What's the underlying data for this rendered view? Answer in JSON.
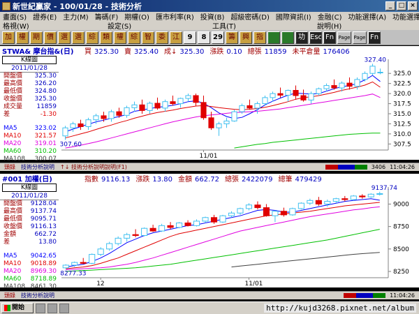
{
  "window": {
    "title": "新世紀贏家 - 100/01/28 - 技術分析"
  },
  "menu": {
    "row1": [
      "畫面(S)",
      "證券(E)",
      "主力(M)",
      "籌碼(F)",
      "期權(O)",
      "匯市利率(R)",
      "投資(B)",
      "超級密碼(D)",
      "國際資訊(I)",
      "金融(C)",
      "功能選擇(A)",
      "功能選擇(P)"
    ],
    "row2": [
      "格視(W)",
      "設定(S)",
      "工具(T)",
      "說明(H)"
    ]
  },
  "toolbar": [
    "加",
    "權",
    "期",
    "價",
    "選",
    "選",
    "綜",
    "類",
    "權",
    "綜",
    "智",
    "委",
    "江",
    "9",
    "8",
    "29",
    "籌",
    "興",
    "指",
    "",
    "",
    "功能",
    "Esc",
    "Fn",
    "Page Up",
    "Page Down",
    "Fn"
  ],
  "top": {
    "symbol": "STWA& 摩台指&(日)",
    "fields": [
      {
        "label": "買",
        "value": "325.30"
      },
      {
        "label": "賣",
        "value": "325.40"
      },
      {
        "label": "成↓",
        "value": "325.30"
      },
      {
        "label": "漲跌",
        "value": "0.10"
      },
      {
        "label": "總張",
        "value": "11859"
      },
      {
        "label": "未平倉量",
        "value": "176406"
      }
    ],
    "kchart": "K線圖",
    "date": "2011/01/28",
    "stats": [
      {
        "k": "開盤價",
        "v": "325.30"
      },
      {
        "k": "最高價",
        "v": "326.20"
      },
      {
        "k": "最低價",
        "v": "324.80"
      },
      {
        "k": "收盤價",
        "v": "325.30"
      },
      {
        "k": "成交量",
        "v": "11859"
      },
      {
        "k": "差",
        "v": "-1.30"
      }
    ],
    "ma": [
      {
        "k": "MA5",
        "v": "323.02",
        "color": "#0000ff"
      },
      {
        "k": "MA10",
        "v": "321.57",
        "color": "#e00000"
      },
      {
        "k": "MA20",
        "v": "319.01",
        "color": "#e000e0"
      },
      {
        "k": "MA60",
        "v": "310.20",
        "color": "#00c000"
      },
      {
        "k": "MA108",
        "v": "300.07",
        "color": "#404040"
      }
    ],
    "status": {
      "s1": "頭錄",
      "s2": "技術分析說明",
      "s3": "↑↓ 技術分析說明說明(F1)",
      "count": "3406",
      "clock": "11:04:26"
    }
  },
  "bottom": {
    "symbol": "#001 加權(日)",
    "fields": [
      {
        "label": "指數",
        "value": "9116.13"
      },
      {
        "label": "漲跌",
        "value": "13.80"
      },
      {
        "label": "金額",
        "value": "662.72"
      },
      {
        "label": "總張",
        "value": "2422079"
      },
      {
        "label": "總筆",
        "value": "479429"
      }
    ],
    "kchart": "K線圖",
    "date": "2011/01/28",
    "stats": [
      {
        "k": "開盤價",
        "v": "9128.04"
      },
      {
        "k": "最高價",
        "v": "9137.74"
      },
      {
        "k": "最低價",
        "v": "9095.71"
      },
      {
        "k": "收盤價",
        "v": "9116.13"
      },
      {
        "k": "金額",
        "v": "662.72"
      },
      {
        "k": "差",
        "v": "13.80"
      }
    ],
    "ma": [
      {
        "k": "MA5",
        "v": "9042.65",
        "color": "#0000ff"
      },
      {
        "k": "MA10",
        "v": "9018.89",
        "color": "#e00000"
      },
      {
        "k": "MA20",
        "v": "8969.30",
        "color": "#e000e0"
      },
      {
        "k": "MA60",
        "v": "8718.89",
        "color": "#00c000"
      },
      {
        "k": "MA108",
        "v": "8461.30",
        "color": "#404040"
      }
    ],
    "status": {
      "s1": "頭錄",
      "s2": "技術分析說明",
      "s3": "",
      "count": "",
      "clock": "11:04:26"
    }
  },
  "taskbar": {
    "start": "開始",
    "watermark": "http://kujd3268.pixnet.net/album"
  },
  "chart_data": [
    {
      "type": "candlestick",
      "title": "STWA& 摩台指&(日)",
      "yticks": [
        307.5,
        310.0,
        312.5,
        315.0,
        317.5,
        320.0,
        322.5,
        325.0
      ],
      "ylim": [
        306.0,
        328.5
      ],
      "xticklabels": [
        "11/01"
      ],
      "annotations": {
        "high": "327.40",
        "low": "307.60"
      },
      "candles": [
        [
          309.5,
          312.0,
          308.5,
          311.5
        ],
        [
          311.5,
          313.0,
          310.5,
          312.5
        ],
        [
          312.5,
          313.5,
          311.0,
          311.8
        ],
        [
          311.8,
          314.0,
          311.0,
          313.5
        ],
        [
          313.5,
          315.0,
          312.5,
          314.5
        ],
        [
          314.5,
          315.5,
          313.0,
          313.8
        ],
        [
          313.8,
          316.0,
          313.0,
          315.5
        ],
        [
          315.5,
          316.5,
          314.0,
          314.6
        ],
        [
          314.6,
          317.0,
          314.0,
          316.5
        ],
        [
          316.5,
          318.0,
          315.5,
          317.2
        ],
        [
          317.2,
          318.5,
          315.0,
          315.8
        ],
        [
          315.8,
          318.0,
          315.0,
          317.6
        ],
        [
          317.6,
          319.0,
          316.0,
          316.4
        ],
        [
          316.4,
          318.5,
          315.5,
          318.0
        ],
        [
          318.0,
          319.5,
          317.0,
          317.5
        ],
        [
          317.5,
          319.0,
          316.5,
          318.8
        ],
        [
          318.8,
          320.0,
          318.0,
          319.5
        ],
        [
          319.5,
          320.0,
          317.0,
          317.8
        ],
        [
          317.8,
          319.5,
          313.5,
          314.0
        ],
        [
          314.0,
          315.5,
          311.0,
          311.5
        ],
        [
          311.5,
          313.0,
          309.5,
          312.5
        ],
        [
          312.5,
          314.0,
          311.5,
          313.2
        ],
        [
          313.2,
          316.0,
          313.0,
          315.5
        ],
        [
          315.5,
          317.5,
          315.0,
          317.0
        ],
        [
          317.0,
          318.5,
          316.0,
          316.4
        ],
        [
          316.4,
          318.0,
          315.0,
          317.5
        ],
        [
          317.5,
          319.5,
          317.0,
          319.0
        ],
        [
          319.0,
          320.5,
          318.0,
          320.0
        ],
        [
          320.0,
          321.5,
          319.0,
          319.6
        ],
        [
          319.6,
          321.0,
          318.0,
          320.8
        ],
        [
          320.8,
          322.0,
          318.5,
          319.5
        ],
        [
          319.5,
          321.0,
          318.0,
          318.4
        ],
        [
          318.4,
          320.5,
          317.5,
          320.0
        ],
        [
          320.0,
          321.5,
          319.5,
          321.2
        ],
        [
          321.2,
          322.5,
          320.5,
          322.0
        ],
        [
          322.0,
          323.5,
          321.0,
          321.4
        ],
        [
          321.4,
          323.0,
          320.5,
          322.6
        ],
        [
          322.6,
          324.0,
          321.0,
          321.8
        ],
        [
          321.8,
          324.0,
          321.0,
          323.5
        ],
        [
          323.5,
          325.5,
          323.0,
          325.0
        ],
        [
          325.0,
          327.4,
          324.5,
          326.8
        ],
        [
          325.3,
          326.2,
          324.8,
          325.3
        ]
      ],
      "ma": [
        {
          "name": "MA5",
          "values": [
            310.5,
            311.2,
            311.8,
            312.4,
            313.0,
            313.4,
            313.9,
            314.3,
            314.8,
            315.6,
            315.9,
            316.3,
            316.6,
            316.8,
            317.1,
            317.5,
            318.0,
            318.2,
            317.6,
            316.5,
            315.2,
            314.3,
            313.8,
            314.1,
            315.0,
            316.0,
            317.2,
            318.1,
            318.9,
            319.6,
            320.1,
            320.0,
            319.9,
            320.0,
            320.6,
            321.2,
            321.7,
            322.0,
            322.5,
            323.4,
            324.5,
            323.0
          ]
        },
        {
          "name": "MA10",
          "values": [
            309.0,
            309.5,
            310.0,
            310.5,
            311.1,
            311.7,
            312.2,
            312.8,
            313.3,
            313.9,
            314.4,
            314.9,
            315.3,
            315.6,
            315.9,
            316.3,
            316.6,
            316.9,
            317.0,
            316.8,
            316.5,
            316.3,
            316.1,
            316.0,
            316.1,
            316.3,
            316.6,
            317.0,
            317.5,
            318.0,
            318.6,
            319.0,
            319.2,
            319.5,
            319.9,
            320.3,
            320.8,
            321.2,
            321.6,
            322.1,
            322.9,
            321.57
          ]
        },
        {
          "name": "MA20",
          "values": [
            306.5,
            306.8,
            307.2,
            307.6,
            308.0,
            308.5,
            309.0,
            309.5,
            310.0,
            310.5,
            311.0,
            311.5,
            312.0,
            312.5,
            313.0,
            313.4,
            313.8,
            314.2,
            314.5,
            314.7,
            314.9,
            315.1,
            315.3,
            315.4,
            315.5,
            315.6,
            315.8,
            316.0,
            316.2,
            316.5,
            316.8,
            317.1,
            317.4,
            317.7,
            318.0,
            318.3,
            318.6,
            318.9,
            319.2,
            319.5,
            319.9,
            319.01
          ]
        },
        {
          "name": "MA60",
          "values": [
            null,
            null,
            null,
            null,
            null,
            null,
            null,
            null,
            null,
            null,
            null,
            null,
            null,
            null,
            null,
            null,
            null,
            null,
            null,
            null,
            null,
            null,
            306.5,
            306.8,
            307.1,
            307.4,
            307.6,
            307.9,
            308.1,
            308.3,
            308.5,
            308.7,
            308.9,
            309.1,
            309.3,
            309.5,
            309.7,
            309.9,
            310.0,
            310.1,
            310.2,
            310.2
          ]
        }
      ]
    },
    {
      "type": "candlestick",
      "title": "#001 加權(日)",
      "yticks": [
        8250,
        8500,
        8750,
        9000
      ],
      "ylim": [
        8180,
        9190
      ],
      "xticklabels": [
        "12",
        "11/01"
      ],
      "annotations": {
        "high": "9137.74",
        "low": "8277.33"
      },
      "candles": [
        [
          8290,
          8330,
          8277,
          8320
        ],
        [
          8320,
          8360,
          8300,
          8350
        ],
        [
          8350,
          8400,
          8330,
          8340
        ],
        [
          8340,
          8450,
          8330,
          8440
        ],
        [
          8440,
          8520,
          8420,
          8500
        ],
        [
          8500,
          8580,
          8480,
          8560
        ],
        [
          8560,
          8640,
          8540,
          8620
        ],
        [
          8620,
          8680,
          8580,
          8660
        ],
        [
          8660,
          8720,
          8630,
          8650
        ],
        [
          8650,
          8740,
          8640,
          8730
        ],
        [
          8730,
          8770,
          8690,
          8700
        ],
        [
          8700,
          8780,
          8690,
          8760
        ],
        [
          8760,
          8800,
          8720,
          8740
        ],
        [
          8740,
          8800,
          8730,
          8790
        ],
        [
          8790,
          8820,
          8750,
          8760
        ],
        [
          8760,
          8830,
          8750,
          8810
        ],
        [
          8810,
          8860,
          8790,
          8850
        ],
        [
          8850,
          8880,
          8780,
          8800
        ],
        [
          8800,
          8880,
          8790,
          8870
        ],
        [
          8870,
          8920,
          8850,
          8900
        ],
        [
          8900,
          8960,
          8880,
          8950
        ],
        [
          8950,
          9010,
          8930,
          8990
        ],
        [
          8990,
          9030,
          8940,
          8960
        ],
        [
          8960,
          9000,
          8860,
          8870
        ],
        [
          8870,
          8930,
          8800,
          8920
        ],
        [
          8920,
          8960,
          8860,
          8880
        ],
        [
          8880,
          8960,
          8870,
          8950
        ],
        [
          8950,
          9020,
          8940,
          9010
        ],
        [
          9010,
          9060,
          8990,
          9040
        ],
        [
          9040,
          9080,
          8980,
          9000
        ],
        [
          9000,
          9050,
          8970,
          9030
        ],
        [
          9030,
          9070,
          9010,
          9060
        ],
        [
          9060,
          9090,
          9030,
          9050
        ],
        [
          9050,
          9100,
          9040,
          9090
        ],
        [
          9090,
          9110,
          9060,
          9080
        ],
        [
          9080,
          9120,
          9070,
          9110
        ],
        [
          9110,
          9137,
          9095,
          9116
        ]
      ],
      "ma": [
        {
          "name": "MA5",
          "values": [
            8300,
            8315,
            8330,
            8360,
            8400,
            8450,
            8510,
            8570,
            8610,
            8650,
            8680,
            8700,
            8720,
            8740,
            8760,
            8770,
            8790,
            8810,
            8830,
            8850,
            8870,
            8900,
            8930,
            8940,
            8930,
            8910,
            8910,
            8930,
            8950,
            8970,
            8990,
            9010,
            9030,
            9040,
            9050,
            9060,
            9042.65
          ]
        },
        {
          "name": "MA10",
          "values": [
            8280,
            8290,
            8300,
            8315,
            8340,
            8370,
            8400,
            8440,
            8480,
            8520,
            8560,
            8600,
            8640,
            8670,
            8690,
            8710,
            8730,
            8750,
            8770,
            8790,
            8810,
            8830,
            8850,
            8870,
            8880,
            8890,
            8900,
            8910,
            8920,
            8935,
            8950,
            8965,
            8980,
            8990,
            9000,
            9010,
            9018.89
          ]
        },
        {
          "name": "MA20",
          "values": [
            8270,
            8275,
            8280,
            8285,
            8290,
            8300,
            8315,
            8330,
            8350,
            8375,
            8400,
            8430,
            8460,
            8490,
            8520,
            8550,
            8580,
            8610,
            8640,
            8670,
            8700,
            8720,
            8740,
            8760,
            8780,
            8800,
            8820,
            8840,
            8860,
            8875,
            8890,
            8905,
            8920,
            8935,
            8945,
            8960,
            8969.3
          ]
        },
        {
          "name": "MA60",
          "values": [
            8250,
            8255,
            8260,
            8265,
            8270,
            8275,
            8280,
            8285,
            8290,
            8300,
            8310,
            8320,
            8330,
            8345,
            8360,
            8375,
            8390,
            8405,
            8420,
            8435,
            8450,
            8465,
            8480,
            8495,
            8510,
            8525,
            8540,
            8555,
            8570,
            8585,
            8600,
            8620,
            8640,
            8660,
            8680,
            8700,
            8718.89
          ]
        },
        {
          "name": "MA108",
          "values": [
            null,
            null,
            null,
            null,
            null,
            null,
            null,
            null,
            null,
            null,
            null,
            null,
            null,
            null,
            null,
            null,
            null,
            null,
            null,
            8300,
            8310,
            8320,
            8330,
            8340,
            8350,
            8360,
            8370,
            8380,
            8390,
            8400,
            8410,
            8420,
            8430,
            8440,
            8448,
            8455,
            8461.3
          ]
        }
      ]
    }
  ]
}
